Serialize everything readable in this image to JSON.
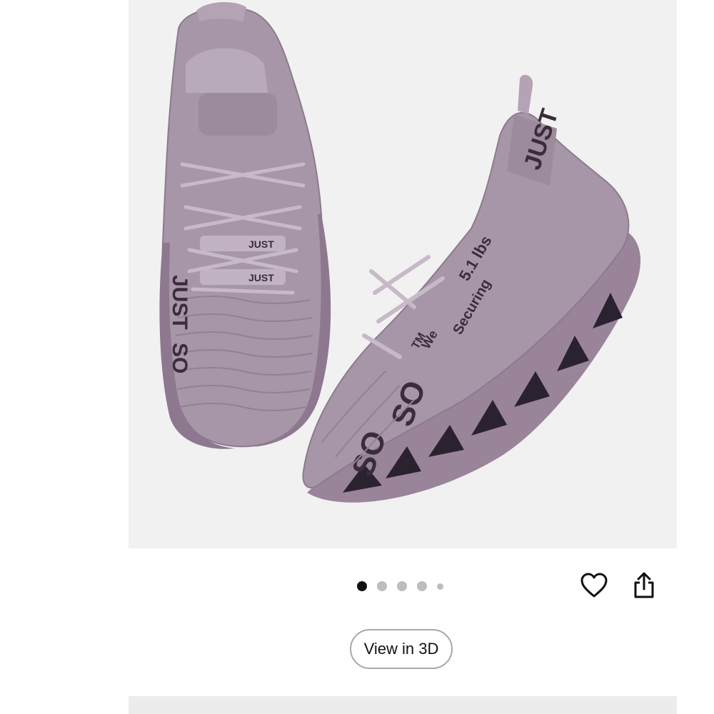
{
  "product_image": {
    "alt": "",
    "colors": {
      "background": "#f2f1f1",
      "upper": "#a796a8",
      "sole": "#9a8499",
      "lettering": "#3a2d3a"
    },
    "printed_text": {
      "just": "JUST",
      "so": "SO",
      "lbs": "5.1 lbs",
      "securing": "Securing",
      "we": "We",
      "tm": "TM"
    }
  },
  "carousel": {
    "dot_count": 5,
    "active_index": 0
  },
  "actions": {
    "favorite_icon": "heart-icon",
    "share_icon": "share-icon"
  },
  "view_3d": {
    "label": "View in 3D"
  }
}
